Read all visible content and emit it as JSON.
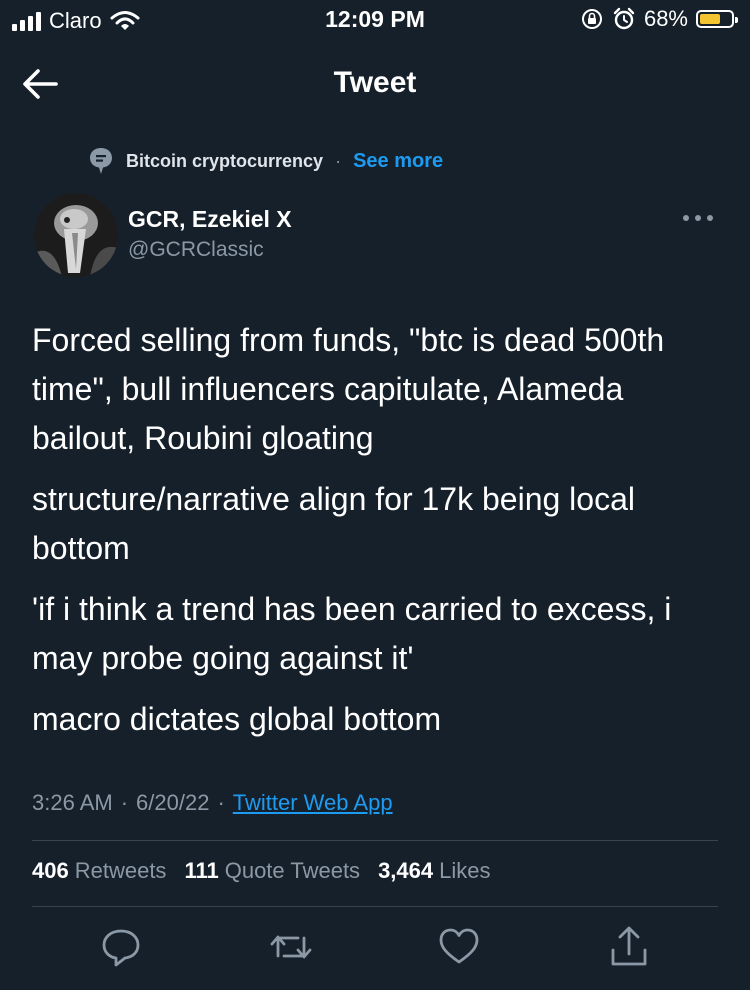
{
  "status_bar": {
    "carrier": "Claro",
    "time": "12:09 PM",
    "battery_percent": "68%",
    "battery_level": 0.68,
    "icons": [
      "signal-icon",
      "wifi-icon",
      "orientation-lock-icon",
      "alarm-icon",
      "battery-icon"
    ]
  },
  "header": {
    "back_icon": "arrow-left-icon",
    "title": "Tweet"
  },
  "topic": {
    "icon": "topic-icon",
    "label": "Bitcoin cryptocurrency",
    "separator": "·",
    "see_more": "See more"
  },
  "author": {
    "name": "GCR, Ezekiel X",
    "handle": "@GCRClassic",
    "more_icon": "more-options-icon"
  },
  "tweet": {
    "paragraphs": [
      "Forced selling from funds,  \"btc is dead 500th time\", bull influencers capitulate, Alameda bailout, Roubini gloating",
      "structure/narrative align for 17k being local bottom",
      "'if i think a trend has been carried to excess, i may probe going against it'",
      "macro dictates global bottom"
    ]
  },
  "meta": {
    "time": "3:26 AM",
    "sep1": "·",
    "date": "6/20/22",
    "sep2": "·",
    "app": "Twitter Web App"
  },
  "stats": {
    "retweets_count": "406",
    "retweets_label": "Retweets",
    "quotes_count": "111",
    "quotes_label": "Quote Tweets",
    "likes_count": "3,464",
    "likes_label": "Likes"
  },
  "actions": [
    "reply-icon",
    "retweet-icon",
    "like-icon",
    "share-icon"
  ],
  "colors": {
    "background": "#16202b",
    "accent": "#1d9bf0",
    "secondary_text": "#8b98a5",
    "divider": "#38444d",
    "battery": "#f4c430"
  }
}
